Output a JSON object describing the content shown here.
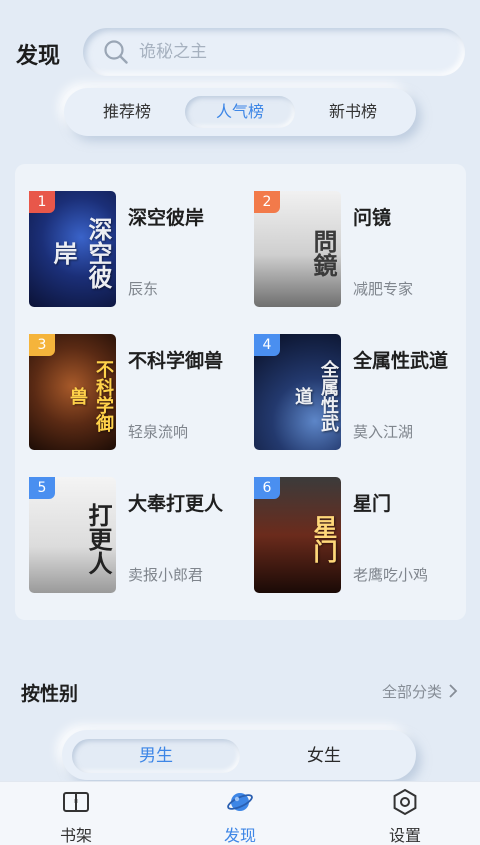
{
  "header": {
    "title": "发现"
  },
  "search": {
    "placeholder": "诡秘之主"
  },
  "ranking_tabs": [
    "推荐榜",
    "人气榜",
    "新书榜"
  ],
  "active_ranking_tab": "人气榜",
  "books": [
    {
      "rank": "1",
      "title": "深空彼岸",
      "author": "辰东",
      "cover_text": "深空彼岸"
    },
    {
      "rank": "2",
      "title": "问镜",
      "author": "减肥专家",
      "cover_text": "問鏡"
    },
    {
      "rank": "3",
      "title": "不科学御兽",
      "author": "轻泉流响",
      "cover_text": "不科学御兽"
    },
    {
      "rank": "4",
      "title": "全属性武道",
      "author": "莫入江湖",
      "cover_text": "全属性武道"
    },
    {
      "rank": "5",
      "title": "大奉打更人",
      "author": "卖报小郎君",
      "cover_text": "打更人"
    },
    {
      "rank": "6",
      "title": "星门",
      "author": "老鹰吃小鸡",
      "cover_text": "星门"
    }
  ],
  "gender_section": {
    "title": "按性别",
    "all_categories": "全部分类",
    "tabs": [
      "男生",
      "女生"
    ],
    "active_tab": "男生"
  },
  "bottom_nav": [
    {
      "label": "书架",
      "icon": "book-icon"
    },
    {
      "label": "发现",
      "icon": "planet-icon",
      "active": true
    },
    {
      "label": "设置",
      "icon": "settings-hexagon-icon"
    }
  ],
  "colors": {
    "accent": "#3d86e6",
    "background": "#e3ebf5",
    "rank_1": "#e8574a",
    "rank_2": "#f27a4a",
    "rank_3": "#f5b43b",
    "rank_other": "#4a8ff0"
  }
}
